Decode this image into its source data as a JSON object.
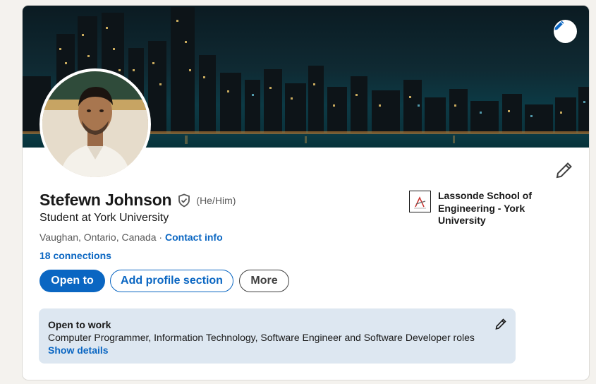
{
  "profile": {
    "name": "Stefewn Johnson",
    "pronouns": "(He/Him)",
    "headline": "Student at York University",
    "location": "Vaughan, Ontario, Canada",
    "separator": " · ",
    "contact_info_label": "Contact info",
    "connections_label": "18 connections"
  },
  "education": {
    "school_name": "Lassonde School of Engineering - York University"
  },
  "actions": {
    "open_to_label": "Open to",
    "add_section_label": "Add profile section",
    "more_label": "More"
  },
  "open_to_work": {
    "title": "Open to work",
    "roles": "Computer Programmer, Information Technology, Software Engineer and Software Developer roles",
    "show_details_label": "Show details"
  },
  "icons": {
    "banner_edit": "pencil-icon",
    "profile_edit": "pencil-icon",
    "verification": "shield-check-icon",
    "open_to_work_edit": "pencil-icon"
  },
  "colors": {
    "brand_blue": "#0a66c2",
    "page_bg": "#f4f2ee",
    "open_to_work_bg": "#dde7f1"
  }
}
